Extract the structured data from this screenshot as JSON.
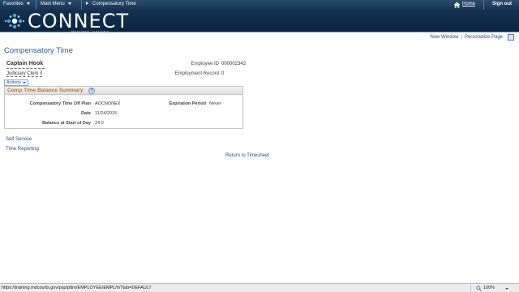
{
  "topnav": {
    "favorites": "Favorites",
    "main_menu": "Main Menu",
    "breadcrumb": "Compensatory Time",
    "home": "Home",
    "sign_out": "Sign out"
  },
  "brand": {
    "name": "CONNECT",
    "subtitle": "Maryland Judiciary"
  },
  "toolbar": {
    "new_window": "New Window",
    "separator": "|",
    "personalize": "Personalize Page"
  },
  "page": {
    "title": "Compensatory Time"
  },
  "employee": {
    "name": "Captain Hook",
    "job_title": "Judiciary Clerk II",
    "id_label": "Employee ID",
    "id_value": "000002342",
    "record_label": "Employment Record",
    "record_value": "0"
  },
  "actions": {
    "label": "Actions"
  },
  "summary": {
    "title": "Comp Time Balance Summary",
    "help": "?",
    "plan_label": "Compensatory Time Off Plan",
    "plan_value": "AOCNONEX",
    "expiration_label": "Expiration Period",
    "expiration_value": "Never",
    "date_label": "Date",
    "date_value": "11/24/2015",
    "balance_label": "Balance at Start of Day",
    "balance_value": "24.0"
  },
  "links": {
    "self_service": "Self Service",
    "time_reporting": "Time Reporting",
    "return": "Return to Timesheet"
  },
  "statusbar": {
    "url": "https://training.mdcourts.gov/psp/pttrn/EMPLOYEE/EMPL/h/?tab=DEFAULT",
    "zoom": "100%"
  },
  "colors": {
    "nav_bg": "#173450",
    "banner_bg": "#0b2441",
    "link": "#1f4d8c",
    "title": "#2b5a94",
    "panel_title": "#c07028"
  }
}
